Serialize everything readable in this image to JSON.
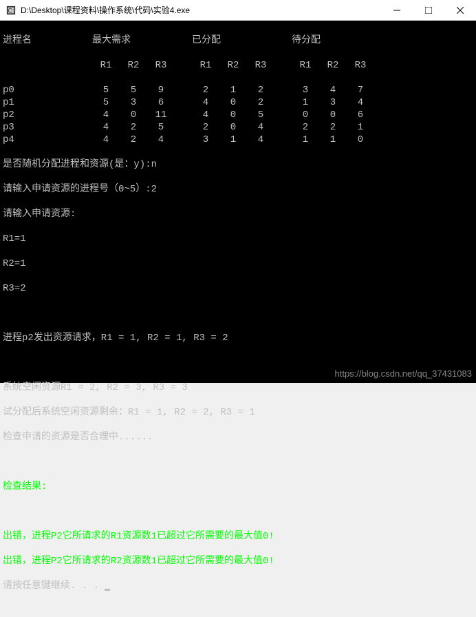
{
  "window": {
    "title": "D:\\Desktop\\课程资料\\操作系统\\代码\\实验4.exe"
  },
  "table": {
    "headers": {
      "proc": "进程名",
      "max": "最大需求",
      "alloc": "已分配",
      "need": "待分配",
      "r1": "R1",
      "r2": "R2",
      "r3": "R3"
    },
    "rows": [
      {
        "name": "p0",
        "max": [
          "5",
          "5",
          "9"
        ],
        "alloc": [
          "2",
          "1",
          "2"
        ],
        "need": [
          "3",
          "4",
          "7"
        ]
      },
      {
        "name": "p1",
        "max": [
          "5",
          "3",
          "6"
        ],
        "alloc": [
          "4",
          "0",
          "2"
        ],
        "need": [
          "1",
          "3",
          "4"
        ]
      },
      {
        "name": "p2",
        "max": [
          "4",
          "0",
          "11"
        ],
        "alloc": [
          "4",
          "0",
          "5"
        ],
        "need": [
          "0",
          "0",
          "6"
        ]
      },
      {
        "name": "p3",
        "max": [
          "4",
          "2",
          "5"
        ],
        "alloc": [
          "2",
          "0",
          "4"
        ],
        "need": [
          "2",
          "2",
          "1"
        ]
      },
      {
        "name": "p4",
        "max": [
          "4",
          "2",
          "4"
        ],
        "alloc": [
          "3",
          "1",
          "4"
        ],
        "need": [
          "1",
          "1",
          "0"
        ]
      }
    ]
  },
  "prompts": {
    "random": "是否随机分配进程和资源(是：y):n",
    "proc_num": "请输入申请资源的进程号（0~5）:2",
    "input_res": "请输入申请资源:",
    "r1": "R1=1",
    "r2": "R2=1",
    "r3": "R3=2"
  },
  "output": {
    "request": "进程p2发出资源请求，R1 = 1, R2 = 1, R3 = 2",
    "idle": "系统空闲资源R1 = 2, R2 = 3, R3 = 3",
    "after": "试分配后系统空闲资源剩余：R1 = 1, R2 = 2, R3 = 1",
    "checking": "检查申请的资源是否合理中......",
    "result_hdr": "检查结果:",
    "err1": "出错，进程P2它所请求的R1资源数1已超过它所需要的最大值0!",
    "err2": "出错，进程P2它所请求的R2资源数1已超过它所需要的最大值0!",
    "continue": "请按任意键继续. . . "
  },
  "watermark": "https://blog.csdn.net/qq_37431083"
}
